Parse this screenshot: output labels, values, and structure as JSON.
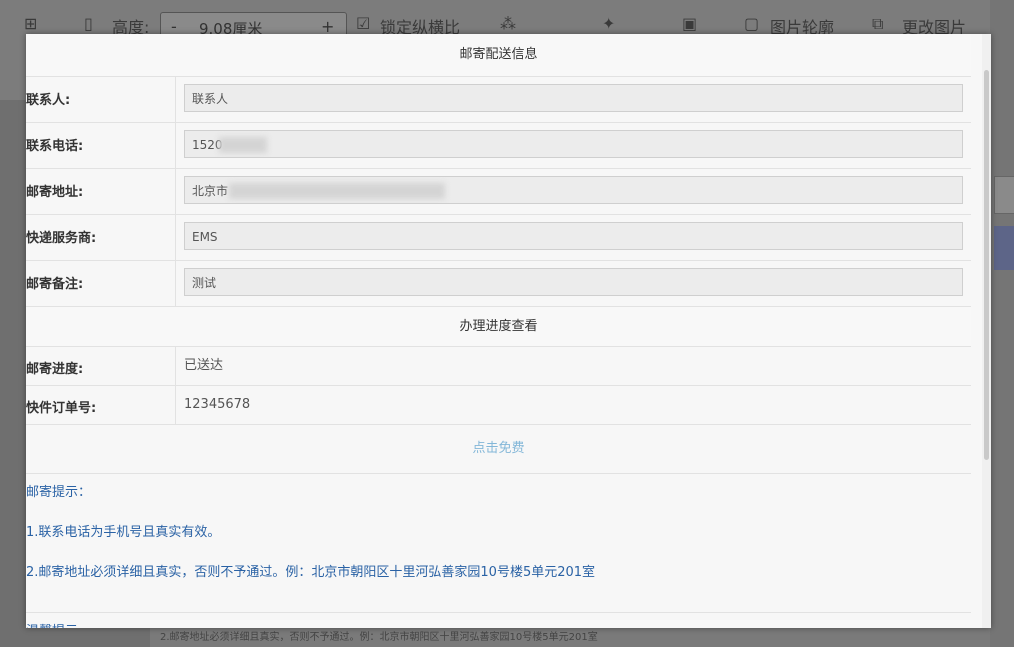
{
  "background": {
    "toolbar": {
      "height_label": "高度:",
      "height_value": "9.08厘米",
      "lock_ratio_label": "锁定纵横比",
      "crop_label": "图片轮廓",
      "change_image_label": "更改图片"
    },
    "bottom_text": "2.邮寄地址必须详细且真实，否则不予通过。例：北京市朝阳区十里河弘善家园10号楼5单元201室"
  },
  "modal": {
    "mail_section_title": "邮寄配送信息",
    "fields": [
      {
        "label": "联系人:",
        "value": "联系人"
      },
      {
        "label": "联系电话:",
        "value": "1520"
      },
      {
        "label": "邮寄地址:",
        "value": "北京市"
      },
      {
        "label": "快递服务商:",
        "value": "EMS"
      },
      {
        "label": "邮寄备注:",
        "value": "测试"
      }
    ],
    "progress_section_title": "办理进度查看",
    "progress": [
      {
        "label": "邮寄进度:",
        "value": "已送达"
      },
      {
        "label": "快件订单号:",
        "value": "12345678"
      }
    ],
    "action_label": "点击免费",
    "tips": {
      "title": "邮寄提示：",
      "items": [
        "1.联系电话为手机号且真实有效。",
        "2.邮寄地址必须详细且真实，否则不予通过。例：北京市朝阳区十里河弘善家园10号楼5单元201室"
      ]
    },
    "cut_off_text": "温馨提示"
  },
  "colors": {
    "tip_text": "#2a62a5",
    "action_text": "#83b7d8"
  }
}
